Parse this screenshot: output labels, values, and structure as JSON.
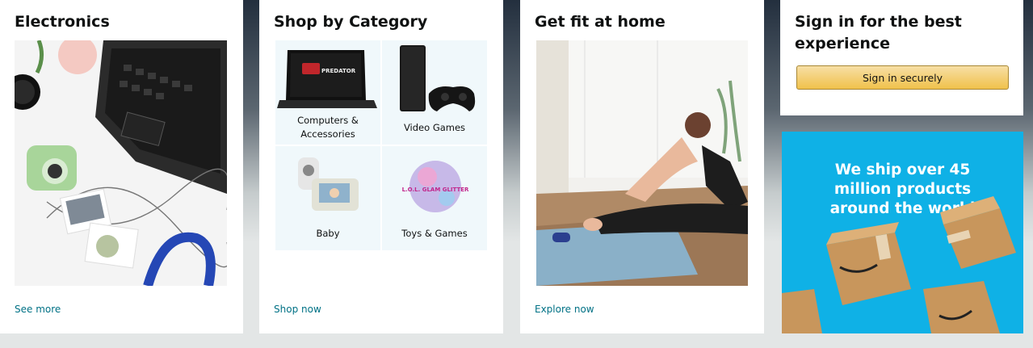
{
  "cards": [
    {
      "title": "Electronics",
      "link": "See more"
    },
    {
      "title": "Shop by Category",
      "link": "Shop now",
      "items": [
        {
          "label": "Computers & Accessories"
        },
        {
          "label": "Video Games"
        },
        {
          "label": "Baby"
        },
        {
          "label": "Toys & Games"
        }
      ]
    },
    {
      "title": "Get fit at home",
      "link": "Explore now"
    },
    {
      "title": "Sign in for the best experience",
      "button": "Sign in securely"
    }
  ],
  "promo": {
    "text": "We ship over 45 million products around the world",
    "background": "#0fb1e6"
  },
  "product_images": {
    "laptop_brand": "PREDATOR",
    "toy_brand": "L.O.L. GLAM GLITTER"
  },
  "colors": {
    "link": "#007185",
    "button_bg": "#f0c14b",
    "page_bg": "#e3e6e6"
  }
}
